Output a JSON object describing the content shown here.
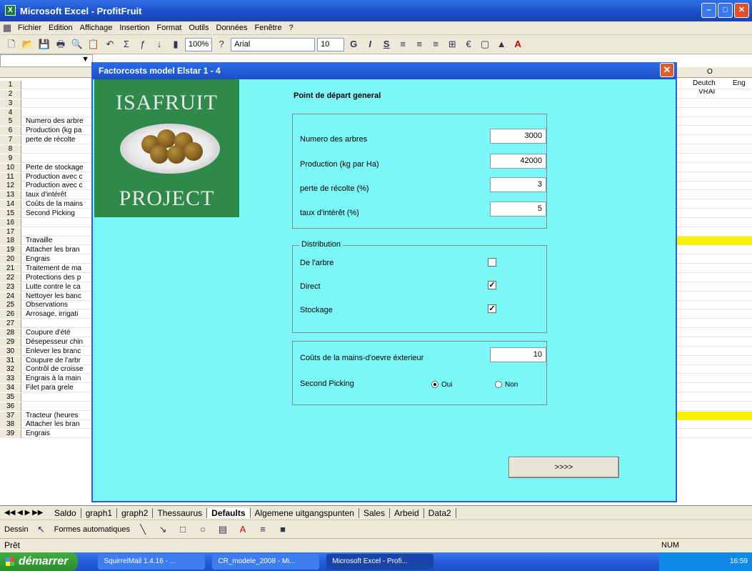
{
  "window": {
    "title": "Microsoft Excel - ProfitFruit"
  },
  "menu": {
    "items": [
      "Fichier",
      "Edition",
      "Affichage",
      "Insertion",
      "Format",
      "Outils",
      "Données",
      "Fenêtre",
      "?"
    ]
  },
  "toolbar": {
    "zoom": "100%",
    "font": "Arial",
    "font_size": "10",
    "bold": "G",
    "italic": "I",
    "underline": "S",
    "currency": "€"
  },
  "sheet": {
    "col_o_header": "O",
    "cell_deutch": "Deutch",
    "cell_eng": "Eng",
    "cell_vrai": "VRAI",
    "rows": [
      {
        "n": "1",
        "t": ""
      },
      {
        "n": "2",
        "t": ""
      },
      {
        "n": "3",
        "t": ""
      },
      {
        "n": "4",
        "t": ""
      },
      {
        "n": "5",
        "t": "Numero des arbre"
      },
      {
        "n": "6",
        "t": "Production (kg pa"
      },
      {
        "n": "7",
        "t": "perte de récolte"
      },
      {
        "n": "8",
        "t": ""
      },
      {
        "n": "9",
        "t": ""
      },
      {
        "n": "10",
        "t": "Perte de stockage"
      },
      {
        "n": "11",
        "t": "Production avec c"
      },
      {
        "n": "12",
        "t": "Production avec c"
      },
      {
        "n": "13",
        "t": "taux d'intérêt"
      },
      {
        "n": "14",
        "t": "Coûts de la mains"
      },
      {
        "n": "15",
        "t": "Second Picking"
      },
      {
        "n": "16",
        "t": ""
      },
      {
        "n": "17",
        "t": ""
      },
      {
        "n": "18",
        "t": "Travaille"
      },
      {
        "n": "19",
        "t": "Attacher les bran"
      },
      {
        "n": "20",
        "t": "Engrais"
      },
      {
        "n": "21",
        "t": "Traitement de ma"
      },
      {
        "n": "22",
        "t": "Protections des p"
      },
      {
        "n": "23",
        "t": "Lutte contre le ca"
      },
      {
        "n": "24",
        "t": "Nettoyer les banc"
      },
      {
        "n": "25",
        "t": "Observations"
      },
      {
        "n": "26",
        "t": "Arrosage, irrigati"
      },
      {
        "n": "27",
        "t": ""
      },
      {
        "n": "28",
        "t": "Coupure d'été"
      },
      {
        "n": "29",
        "t": "Désepesseur chin"
      },
      {
        "n": "30",
        "t": "Enlever les branc"
      },
      {
        "n": "31",
        "t": "Coupure de l'arbr"
      },
      {
        "n": "32",
        "t": "Contrôl de croisse"
      },
      {
        "n": "33",
        "t": "Engrais à la main"
      },
      {
        "n": "34",
        "t": "Filet para grele"
      },
      {
        "n": "35",
        "t": ""
      },
      {
        "n": "36",
        "t": ""
      },
      {
        "n": "37",
        "t": "Tracteur (heures"
      },
      {
        "n": "38",
        "t": "Attacher les bran"
      },
      {
        "n": "39",
        "t": "Engrais"
      }
    ]
  },
  "sheet_tabs": [
    "Saldo",
    "graph1",
    "graph2",
    "Thessaurus",
    "Defaults",
    "Algemene uitgangspunten",
    "Sales",
    "Arbeid",
    "Data2"
  ],
  "drawing": {
    "dessin": "Dessin",
    "formes": "Formes automatiques"
  },
  "status": {
    "ready": "Prêt",
    "num": "NUM"
  },
  "taskbar": {
    "start": "démarrer",
    "tasks": [
      "SquirrelMail 1.4.16 - ...",
      "CR_modele_2008 - Mi...",
      "Microsoft Excel - Profi..."
    ],
    "clock": "16:59"
  },
  "dialog": {
    "title": "Factorcosts model Elstar 1 - 4",
    "logo_top": "ISAFRUIT",
    "logo_bottom": "PROJECT",
    "section_title": "Point de départ general",
    "fields": [
      {
        "label": "Numero des arbres",
        "value": "3000"
      },
      {
        "label": "Production (kg par Ha)",
        "value": "42000"
      },
      {
        "label": "perte de récolte (%)",
        "value": "3"
      },
      {
        "label": "taux d'intérêt (%)",
        "value": "5"
      }
    ],
    "distribution": {
      "legend": "Distribution",
      "options": [
        {
          "label": "De l'arbre",
          "checked": "false"
        },
        {
          "label": "Direct",
          "checked": "true"
        },
        {
          "label": "Stockage",
          "checked": "true"
        }
      ]
    },
    "labour": {
      "label": "Coûts de la mains-d'oevre éxterieur",
      "value": "10"
    },
    "second_picking": {
      "label": "Second Picking",
      "yes": "Oui",
      "no": "Non",
      "selected": "Oui"
    },
    "next_label": ">>>>"
  }
}
